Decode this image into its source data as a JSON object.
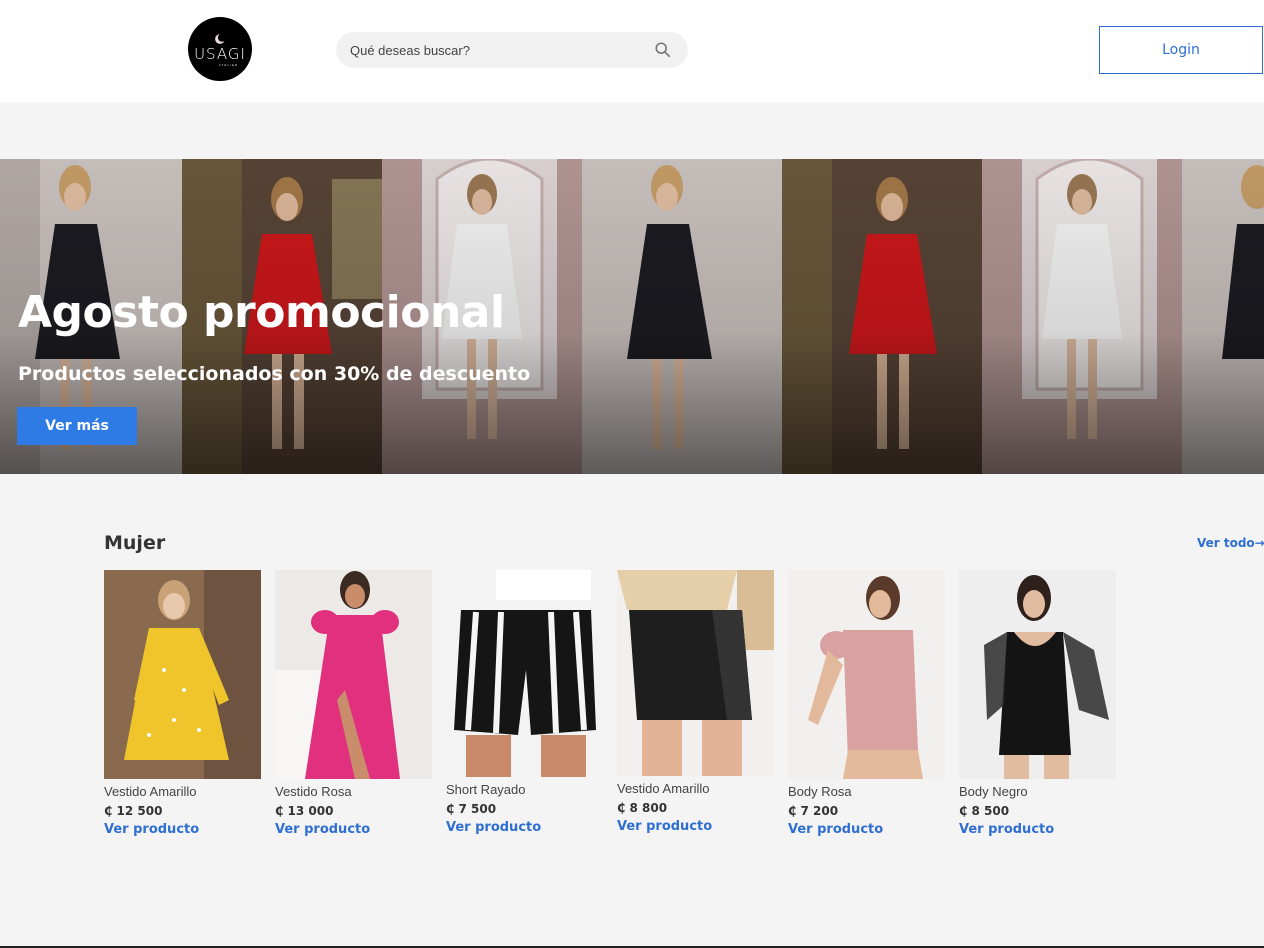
{
  "header": {
    "logo": {
      "brand": "USAGI",
      "sub": "ATELIER"
    },
    "search": {
      "placeholder": "Qué deseas buscar?",
      "icon": "search-icon"
    },
    "login_label": "Login"
  },
  "banner": {
    "title": "Agosto promocional",
    "subtitle": "Productos seleccionados con 30% de descuento",
    "button_label": "Ver más"
  },
  "section": {
    "title": "Mujer",
    "view_all_label": "Ver todo→"
  },
  "products": [
    {
      "name": "Vestido Amarillo",
      "price": "₵ 12 500",
      "link": "Ver producto"
    },
    {
      "name": "Vestido Rosa",
      "price": "₵ 13 000",
      "link": "Ver producto"
    },
    {
      "name": "Short Rayado",
      "price": "₵ 7 500",
      "link": "Ver producto"
    },
    {
      "name": "Vestido Amarillo",
      "price": "₵ 8 800",
      "link": "Ver producto"
    },
    {
      "name": "Body Rosa",
      "price": "₵ 7 200",
      "link": "Ver producto"
    },
    {
      "name": "Body Negro",
      "price": "₵ 8 500",
      "link": "Ver producto"
    }
  ],
  "colors": {
    "accent": "#2f6fd1",
    "button": "#2f7be6",
    "background": "#f4f4f4"
  }
}
